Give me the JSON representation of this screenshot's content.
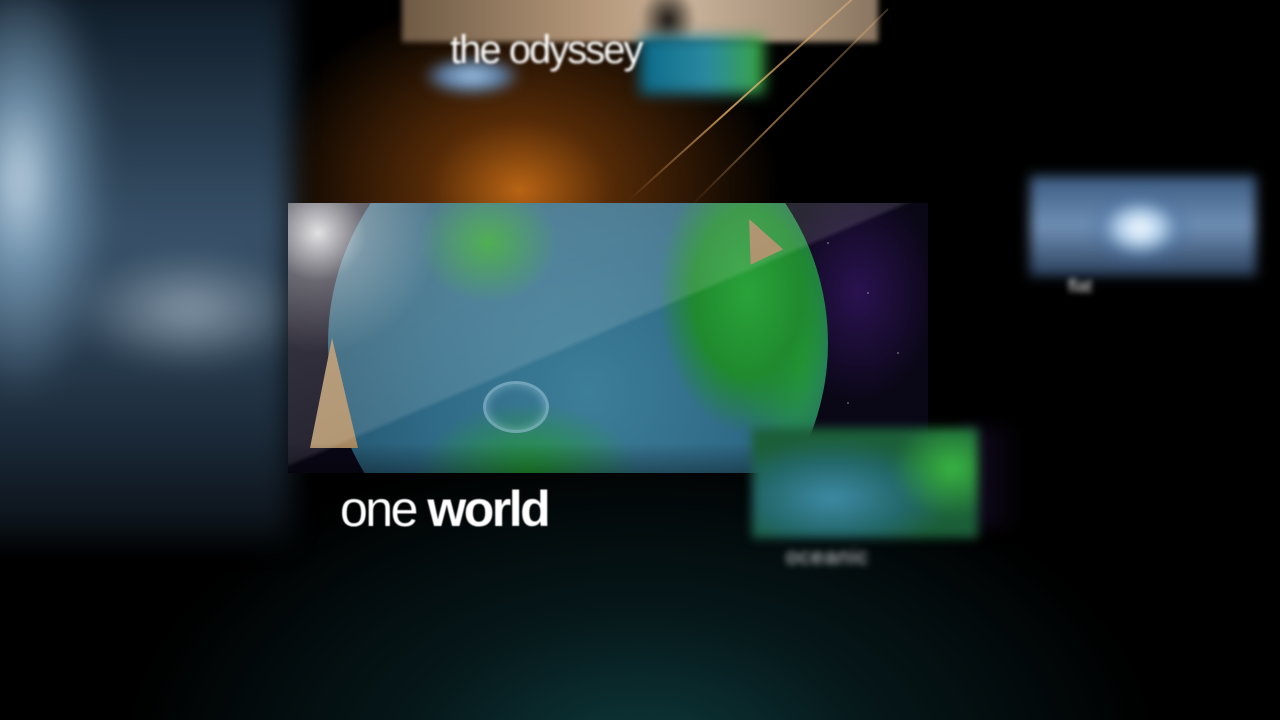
{
  "carousel": {
    "top_item": {
      "title": "the odyssey"
    },
    "featured_item": {
      "title_light": "one",
      "title_bold": "world"
    },
    "right_item": {
      "label": "flat"
    },
    "lower_item": {
      "label": "oceanic"
    }
  },
  "colors": {
    "background": "#000000",
    "accent_glow": "#b86414",
    "teal_glow": "#0e3a3c",
    "title_text": "#ffffff"
  }
}
